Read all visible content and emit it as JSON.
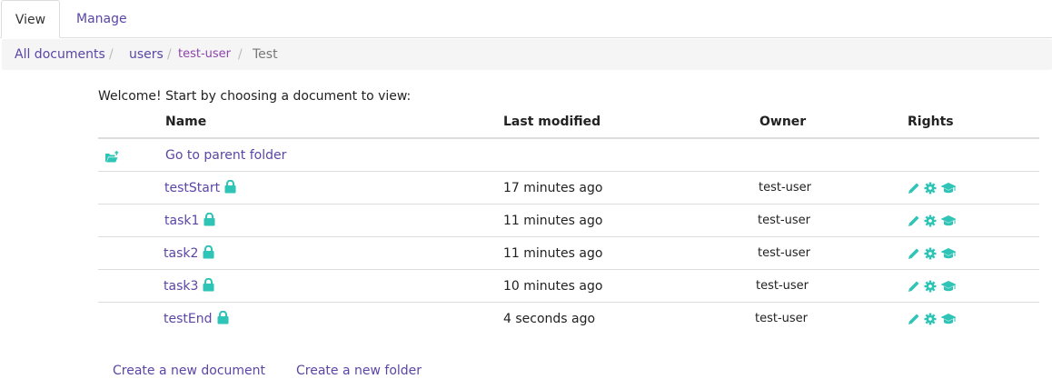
{
  "tabs": [
    {
      "label": "View",
      "active": true
    },
    {
      "label": "Manage",
      "active": false
    }
  ],
  "breadcrumb": {
    "root": "All documents",
    "folder": "users",
    "user": "test-user",
    "current": "Test",
    "separator": "/"
  },
  "welcome": "Welcome! Start by choosing a document to view:",
  "table": {
    "headers": [
      "Name",
      "Last modified",
      "Owner",
      "Rights"
    ],
    "parent_label": "Go to parent folder",
    "rows": [
      {
        "name": "testStart",
        "modified": "17 minutes ago",
        "owner": "test-user"
      },
      {
        "name": "task1",
        "modified": "11 minutes ago",
        "owner": "test-user"
      },
      {
        "name": "task2",
        "modified": "11 minutes ago",
        "owner": "test-user"
      },
      {
        "name": "task3",
        "modified": "10 minutes ago",
        "owner": "test-user"
      },
      {
        "name": "testEnd",
        "modified": "4 seconds ago",
        "owner": "test-user"
      }
    ]
  },
  "actions": {
    "new_document": "Create a new document",
    "new_folder": "Create a new folder"
  },
  "icons": {
    "parent": "folder-open-icon",
    "lock": "lock-icon",
    "rights": [
      "pencil-icon",
      "gear-icon",
      "graduation-cap-icon"
    ]
  },
  "colors": {
    "link": "#5b46a6",
    "icon_teal": "#2ec4b6",
    "user_purple": "#8e44ad"
  }
}
